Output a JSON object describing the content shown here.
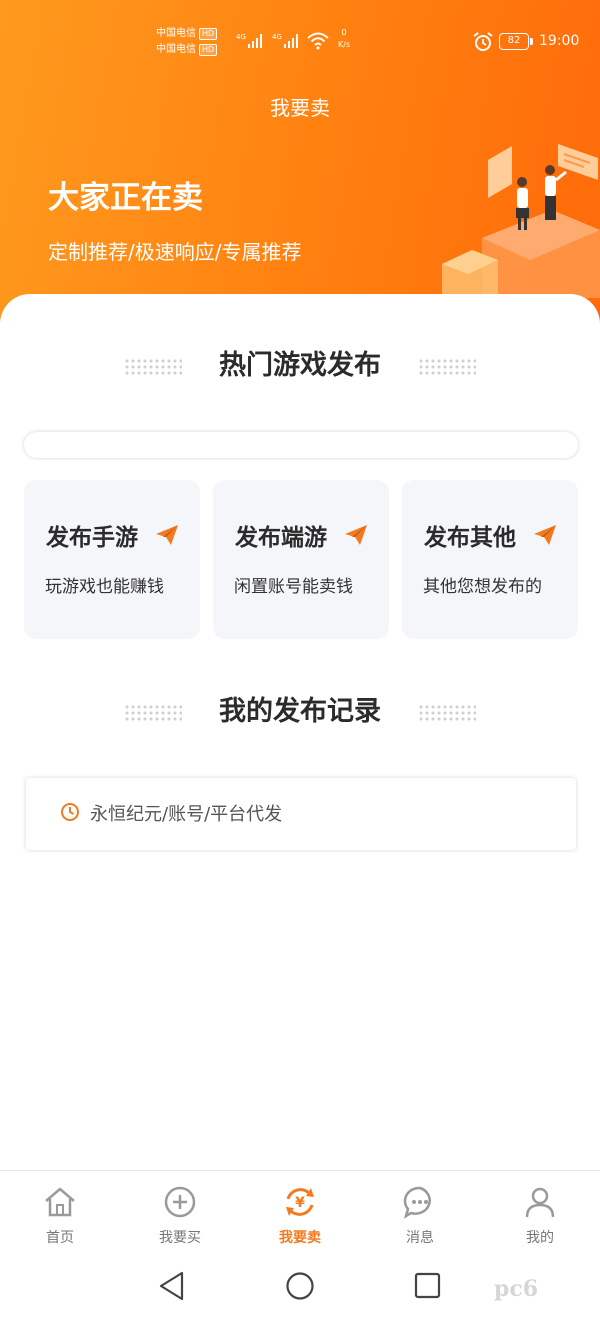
{
  "status_bar": {
    "carrier_1": "中国电信",
    "carrier_2": "中国电信",
    "hd": "HD",
    "net_type": "4G",
    "speed_value": "0",
    "speed_unit": "K/s",
    "battery": "82",
    "time": "19:00"
  },
  "header": {
    "page_title": "我要卖",
    "hero_title": "大家正在卖",
    "hero_subtitle": "定制推荐/极速响应/专属推荐"
  },
  "sections": {
    "hot_title": "热门游戏发布",
    "records_title": "我的发布记录"
  },
  "cards": [
    {
      "title": "发布手游",
      "subtitle": "玩游戏也能赚钱",
      "icon": "paper-plane-icon"
    },
    {
      "title": "发布端游",
      "subtitle": "闲置账号能卖钱",
      "icon": "paper-plane-icon"
    },
    {
      "title": "发布其他",
      "subtitle": "其他您想发布的",
      "icon": "paper-plane-icon"
    }
  ],
  "records": [
    {
      "text": "永恒纪元/账号/平台代发",
      "icon": "clock-icon"
    }
  ],
  "bottom_nav": [
    {
      "label": "首页",
      "icon": "home-icon"
    },
    {
      "label": "我要买",
      "icon": "plus-circle-icon"
    },
    {
      "label": "我要卖",
      "icon": "yen-refresh-icon",
      "active": true
    },
    {
      "label": "消息",
      "icon": "chat-icon"
    },
    {
      "label": "我的",
      "icon": "user-icon"
    }
  ],
  "watermark": "pc6",
  "colors": {
    "accent": "#f47a1f",
    "header_gradient_start": "#ff9a1e",
    "header_gradient_end": "#ff6a0a",
    "card_bg": "#f4f6fa"
  }
}
